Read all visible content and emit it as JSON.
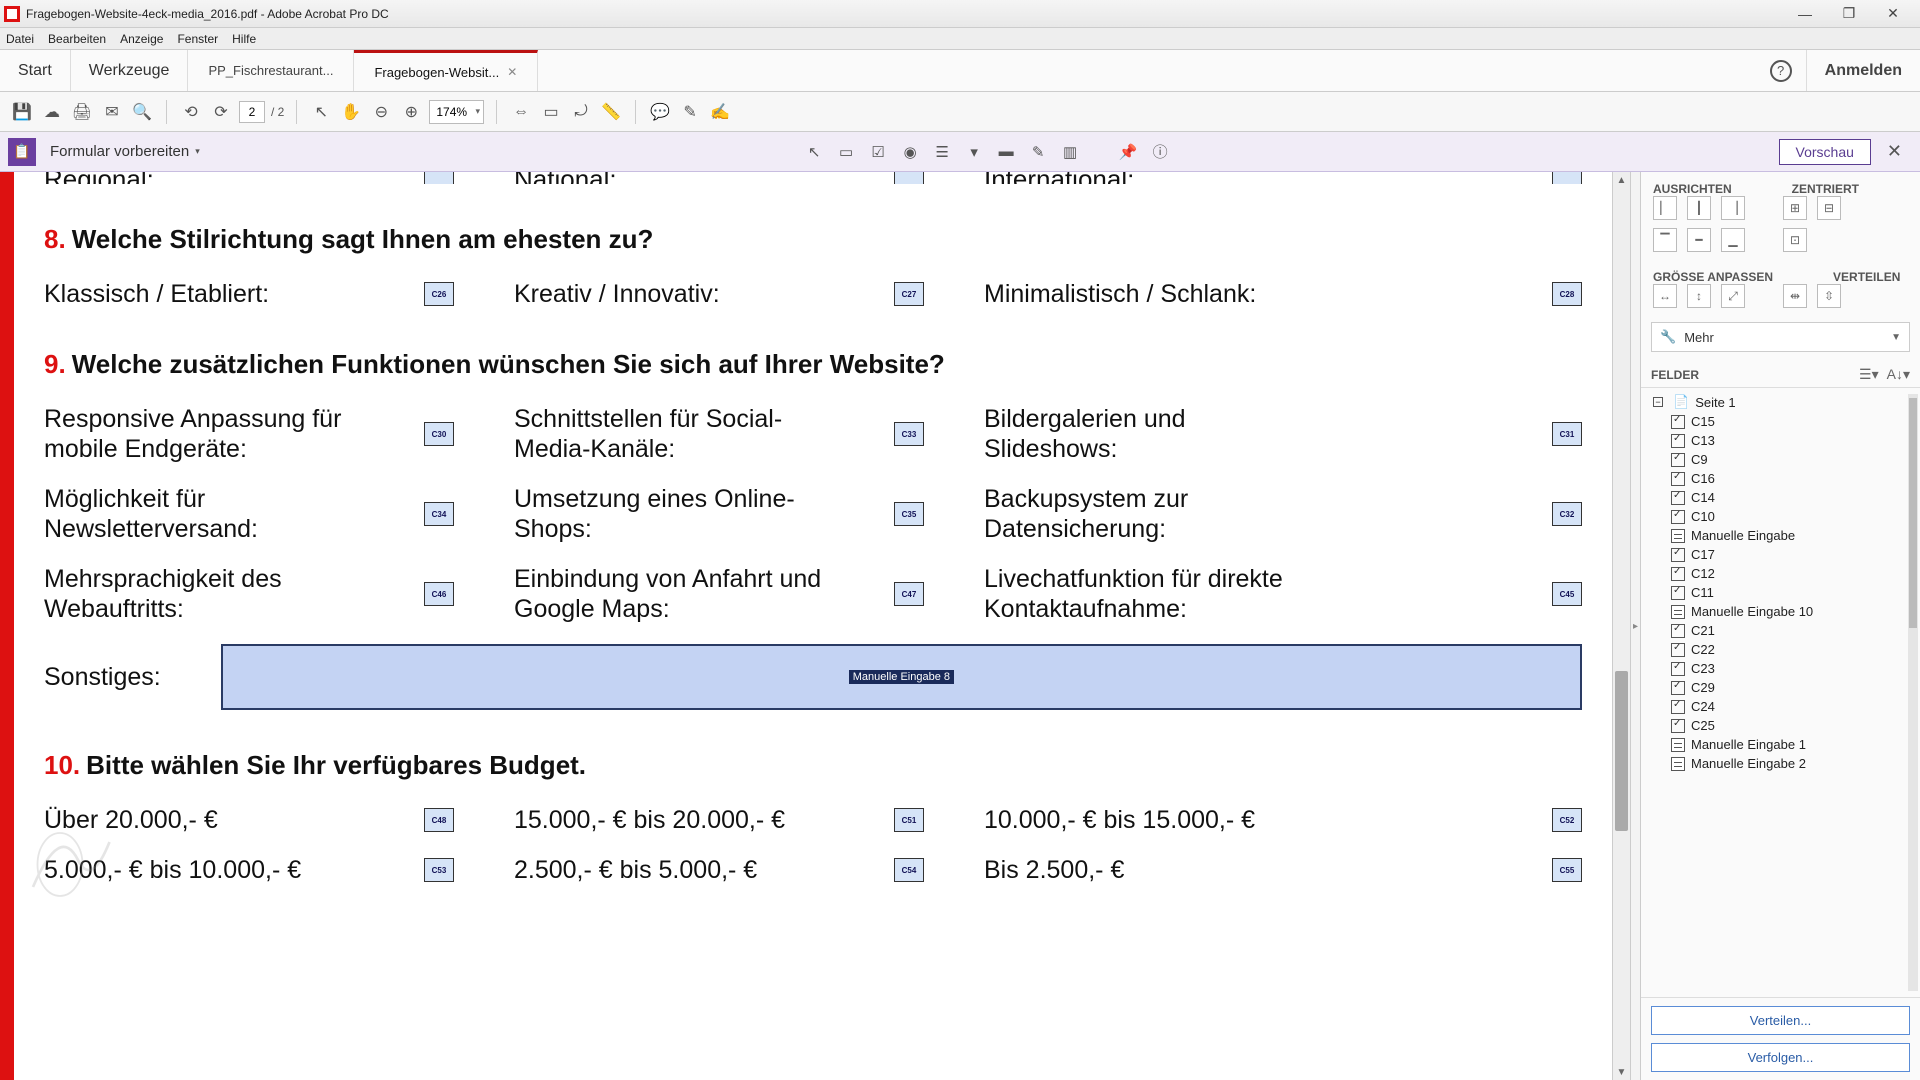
{
  "titlebar": {
    "text": "Fragebogen-Website-4eck-media_2016.pdf - Adobe Acrobat Pro DC"
  },
  "window": {
    "min": "—",
    "max": "❐",
    "close": "✕"
  },
  "menu": [
    "Datei",
    "Bearbeiten",
    "Anzeige",
    "Fenster",
    "Hilfe"
  ],
  "tabs": {
    "start": "Start",
    "tools": "Werkzeuge",
    "file1": "PP_Fischrestaurant...",
    "file2": "Fragebogen-Websit...",
    "anmelden": "Anmelden"
  },
  "toolbar": {
    "page_current": "2",
    "page_total": "/  2",
    "zoom": "174%"
  },
  "formbar": {
    "label": "Formular vorbereiten",
    "vorschau": "Vorschau"
  },
  "doc": {
    "cut": {
      "l": "Regional:",
      "m": "National:",
      "r": "International:"
    },
    "q8": {
      "num": "8.",
      "title": "Welche Stilrichtung sagt Ihnen am ehesten zu?",
      "a": "Klassisch / Etabliert:",
      "b": "Kreativ / Innovativ:",
      "c": "Minimalistisch / Schlank:",
      "ca": "C26",
      "cb": "C27",
      "cc": "C28"
    },
    "q9": {
      "num": "9.",
      "title": "Welche zusätzlichen Funktionen wünschen Sie sich auf Ihrer Website?",
      "r1a": "Responsive Anpassung für mobile Endgeräte:",
      "r1b": "Schnittstellen für Social-Media-Kanäle:",
      "r1c": "Bildergalerien und Slideshows:",
      "c1a": "C30",
      "c1b": "C33",
      "c1c": "C31",
      "r2a": "Möglichkeit für Newsletterversand:",
      "r2b": "Umsetzung eines Online-Shops:",
      "r2c": "Backupsystem zur Datensicherung:",
      "c2a": "C34",
      "c2b": "C35",
      "c2c": "C32",
      "r3a": "Mehrsprachigkeit des Webauftritts:",
      "r3b": "Einbindung von Anfahrt und Google Maps:",
      "r3c": "Livechatfunktion für direkte Kontaktaufnahme:",
      "c3a": "C46",
      "c3b": "C47",
      "c3c": "C45",
      "sonst": "Sonstiges:",
      "sonst_field": "Manuelle Eingabe 8"
    },
    "q10": {
      "num": "10.",
      "title": "Bitte wählen Sie Ihr verfügbares Budget.",
      "r1a": "Über 20.000,- €",
      "r1b": "15.000,- € bis 20.000,- €",
      "r1c": "10.000,- € bis 15.000,- €",
      "c1a": "C48",
      "c1b": "C51",
      "c1c": "C52",
      "r2a": "5.000,- € bis 10.000,- €",
      "r2b": "2.500,- € bis 5.000,- €",
      "r2c": "Bis 2.500,- €",
      "c2a": "C53",
      "c2b": "C54",
      "c2c": "C55"
    }
  },
  "right": {
    "ausrichten": "AUSRICHTEN",
    "zentriert": "ZENTRIERT",
    "groesse": "GRÖSSE ANPASSEN",
    "verteilen": "VERTEILEN",
    "mehr": "Mehr",
    "felder": "FELDER",
    "root": "Seite 1",
    "items": [
      {
        "t": "cb",
        "l": "C15"
      },
      {
        "t": "cb",
        "l": "C13"
      },
      {
        "t": "cb",
        "l": "C9"
      },
      {
        "t": "cb",
        "l": "C16"
      },
      {
        "t": "cb",
        "l": "C14"
      },
      {
        "t": "cb",
        "l": "C10"
      },
      {
        "t": "tf",
        "l": "Manuelle Eingabe"
      },
      {
        "t": "cb",
        "l": "C17"
      },
      {
        "t": "cb",
        "l": "C12"
      },
      {
        "t": "cb",
        "l": "C11"
      },
      {
        "t": "tf",
        "l": "Manuelle Eingabe 10"
      },
      {
        "t": "cb",
        "l": "C21"
      },
      {
        "t": "cb",
        "l": "C22"
      },
      {
        "t": "cb",
        "l": "C23"
      },
      {
        "t": "cb",
        "l": "C29"
      },
      {
        "t": "cb",
        "l": "C24"
      },
      {
        "t": "cb",
        "l": "C25"
      },
      {
        "t": "tf",
        "l": "Manuelle Eingabe 1"
      },
      {
        "t": "tf",
        "l": "Manuelle Eingabe 2"
      }
    ],
    "verteilen_btn": "Verteilen...",
    "verfolgen_btn": "Verfolgen..."
  }
}
